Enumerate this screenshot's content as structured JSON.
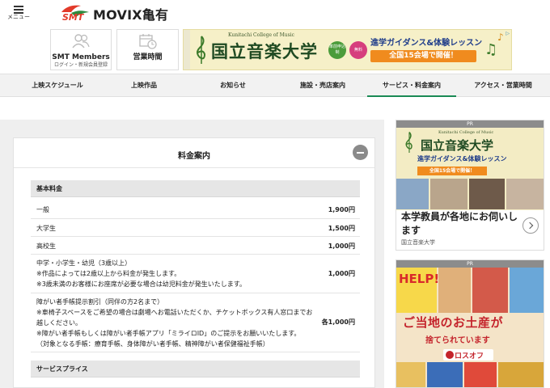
{
  "header": {
    "menu_label": "メニュー",
    "logo_text": "SMT",
    "site_title": "MOVIX亀有"
  },
  "top_boxes": {
    "members": {
      "title": "SMT Members",
      "sub": "ログイン・新規会員登録",
      "icon": "people-icon"
    },
    "schedule": {
      "title": "営業時間",
      "icon": "calendar-clock-icon"
    }
  },
  "top_ad": {
    "college_en": "Kunitachi College of Music",
    "name": "国立音楽大学",
    "badge1": "率前申込制",
    "badge2": "無料",
    "guidance": "進学ガイダンス&体験レッスン",
    "venues": "全国15会場で開催！"
  },
  "nav": {
    "items": [
      {
        "label": "上映スケジュール"
      },
      {
        "label": "上映作品"
      },
      {
        "label": "お知らせ"
      },
      {
        "label": "施設・売店案内"
      },
      {
        "label": "サービス・料金案内"
      },
      {
        "label": "アクセス・営業時間"
      }
    ],
    "active_index": 4
  },
  "panel": {
    "title": "料金案内",
    "section1": "基本料金",
    "rows": [
      {
        "label": [
          "一般"
        ],
        "price": "1,900円"
      },
      {
        "label": [
          "大学生"
        ],
        "price": "1,500円"
      },
      {
        "label": [
          "高校生"
        ],
        "price": "1,000円"
      },
      {
        "label": [
          "中学・小学生・幼児（3歳以上）",
          "※作品によっては2歳以上から料金が発生します。",
          "※3歳未満のお客様にお座席が必要な場合は幼児料金が発生いたします。"
        ],
        "price": "1,000円"
      },
      {
        "label": [
          "障がい者手帳提示割引（同伴の方2名まで）",
          "※車椅子スペースをご希望の場合は劇場へお電話いただくか、チケットボックス有人窓口までお",
          "越しください。",
          "※障がい者手帳もしくは障がい者手帳アプリ「ミライロID」のご提示をお願いいたします。",
          "（対象となる手帳：療育手帳、身体障がい者手帳、精神障がい者保健福祉手帳）"
        ],
        "price": "各1,000円"
      }
    ],
    "section2": "サービスプライス"
  },
  "side_ads": {
    "pr_label": "PR",
    "ad1": {
      "college_en": "Kunitachi College of Music",
      "name": "国立音楽大学",
      "guidance": "進学ガイダンス&体験レッスン",
      "venues": "全国15会場で開催！",
      "text": "本学教員が各地にお伺いします",
      "footer": "国立音楽大学"
    },
    "ad2": {
      "help": "HELP!",
      "title": "ご当地のお土産が",
      "sub": "捨てられています",
      "logo": "ロスオフ"
    }
  },
  "colors": {
    "accent_green": "#1a8a55",
    "ad_orange": "#f08b1e",
    "ad_red": "#c4242c"
  }
}
